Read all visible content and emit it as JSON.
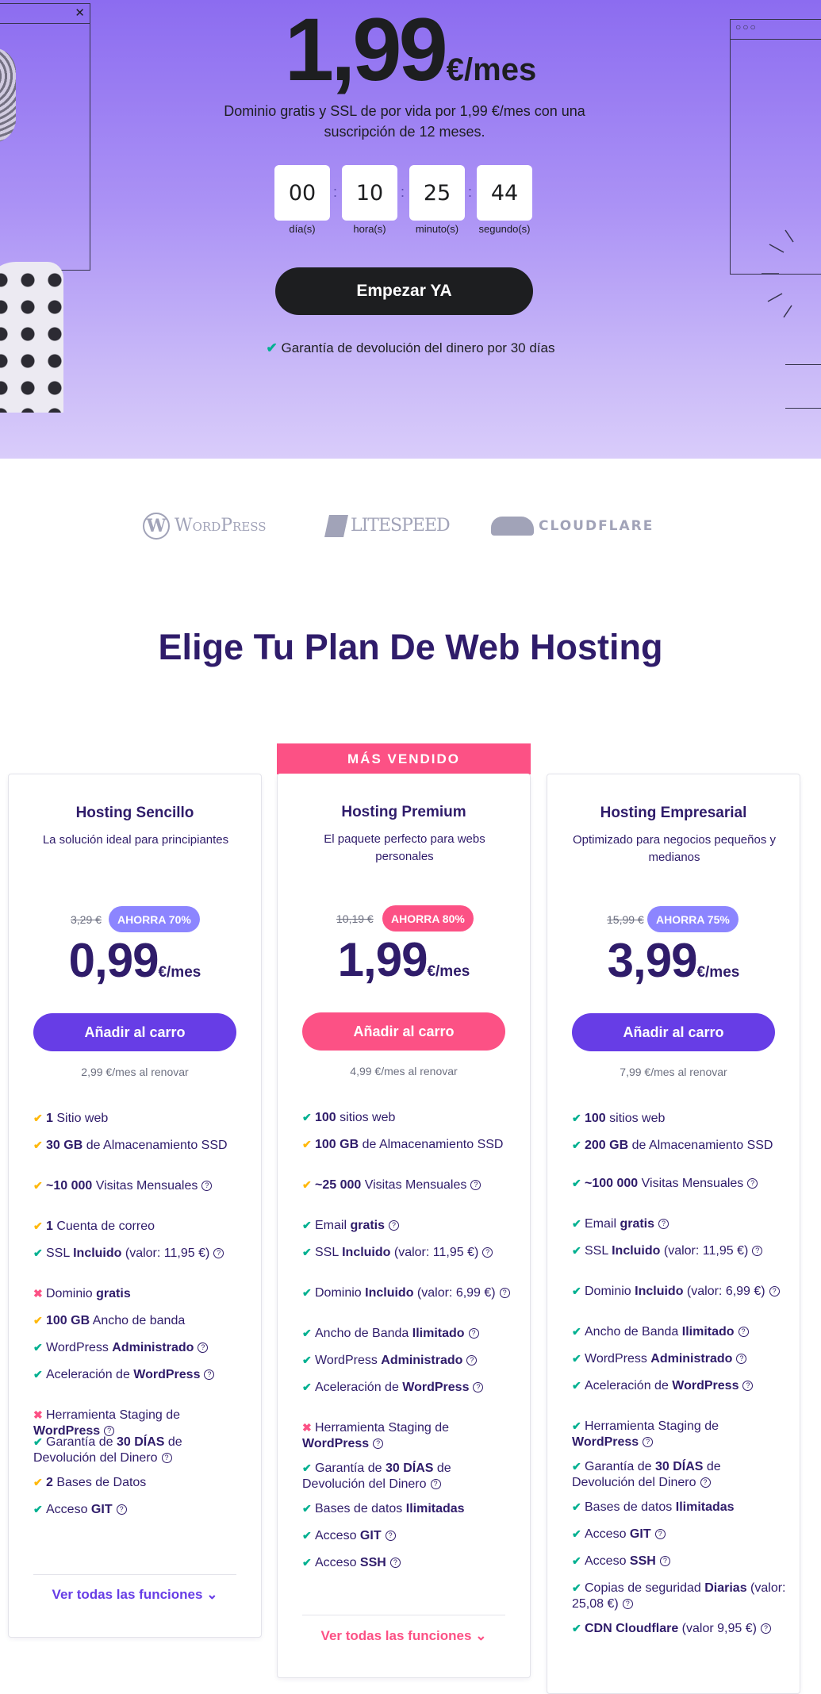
{
  "hero": {
    "price": "1,99",
    "price_unit": "€/mes",
    "subtitle": "Dominio gratis y SSL de por vida por 1,99 €/mes con una suscripción de 12 meses.",
    "countdown": [
      {
        "value": "00",
        "label": "día(s)"
      },
      {
        "value": "10",
        "label": "hora(s)"
      },
      {
        "value": "25",
        "label": "minuto(s)"
      },
      {
        "value": "44",
        "label": "segundo(s)"
      }
    ],
    "cta_label": "Empezar YA",
    "guarantee": "Garantía de devolución del dinero por 30 días"
  },
  "logos": [
    "WordPress",
    "LITESPEED",
    "CLOUDFLARE"
  ],
  "section_title": "Elige Tu Plan De Web Hosting",
  "ribbon": "MÁS VENDIDO",
  "colors": {
    "purple": "#673de6",
    "pink": "#fc5185",
    "badge_purple": "#8c85ff",
    "navy": "#2f1c6a",
    "check": "#00b090",
    "warn": "#ffb80b"
  },
  "plans": [
    {
      "title": "Hosting Sencillo",
      "desc": "La solución ideal para principiantes",
      "old_price": "3,29 €",
      "badge": "AHORRA 70%",
      "price": "0,99",
      "unit": "€/mes",
      "button": "Añadir al carro",
      "renew": "2,99 €/mes al renovar",
      "more": "Ver todas las funciones"
    },
    {
      "title": "Hosting Premium",
      "desc": "El paquete perfecto para webs personales",
      "old_price": "10,19 €",
      "badge": "AHORRA 80%",
      "price": "1,99",
      "unit": "€/mes",
      "button": "Añadir al carro",
      "renew": "4,99 €/mes al renovar",
      "more": "Ver todas las funciones"
    },
    {
      "title": "Hosting Empresarial",
      "desc": "Optimizado para negocios pequeños y medianos",
      "old_price": "15,99 €",
      "badge": "AHORRA 75%",
      "price": "3,99",
      "unit": "€/mes",
      "button": "Añadir al carro",
      "renew": "7,99 €/mes al renovar"
    }
  ],
  "features_basic": [
    [
      "warn",
      "1",
      " Sitio web",
      "",
      false
    ],
    [
      "warn",
      "30 GB",
      " de Almacenamiento SSD",
      "",
      false
    ],
    [
      "warn",
      "~10 000",
      " Visitas Mensuales",
      "",
      true
    ],
    [
      "warn",
      "1",
      " Cuenta de correo",
      "",
      false
    ],
    [
      "ok",
      "",
      "SSL ",
      "Incluido|| (valor: 11,95 €)",
      true
    ],
    [
      "no",
      "",
      "Dominio ",
      "gratis",
      false
    ],
    [
      "warn",
      "100 GB",
      " Ancho de banda",
      "",
      false
    ],
    [
      "ok",
      "",
      "WordPress ",
      "Administrado",
      true
    ],
    [
      "ok",
      "",
      "Aceleración de ",
      "WordPress",
      true
    ],
    [
      "no",
      "",
      "Herramienta Staging de ",
      "WordPress",
      true
    ],
    [
      "ok",
      "",
      "Garantía de ",
      "30 DÍAS|| de Devolución del Dinero",
      true
    ],
    [
      "warn",
      "2",
      " Bases de Datos",
      "",
      false
    ],
    [
      "ok",
      "",
      "Acceso ",
      "GIT",
      true
    ]
  ],
  "features_premium": [
    [
      "ok",
      "100",
      " sitios web",
      "",
      false
    ],
    [
      "warn",
      "100 GB",
      " de Almacenamiento SSD",
      "",
      false
    ],
    [
      "warn",
      "~25 000",
      " Visitas Mensuales",
      "",
      true
    ],
    [
      "ok",
      "",
      "Email ",
      "gratis",
      true
    ],
    [
      "ok",
      "",
      "SSL ",
      "Incluido|| (valor: 11,95 €)",
      true
    ],
    [
      "ok",
      "",
      "Dominio ",
      "Incluido|| (valor: 6,99 €)",
      true
    ],
    [
      "ok",
      "",
      "Ancho de Banda ",
      "Ilimitado",
      true
    ],
    [
      "ok",
      "",
      "WordPress ",
      "Administrado",
      true
    ],
    [
      "ok",
      "",
      "Aceleración de ",
      "WordPress",
      true
    ],
    [
      "no",
      "",
      "Herramienta Staging de ",
      "WordPress",
      true
    ],
    [
      "ok",
      "",
      "Garantía de ",
      "30 DÍAS|| de Devolución del Dinero",
      true
    ],
    [
      "ok",
      "",
      "Bases de datos ",
      "Ilimitadas",
      false
    ],
    [
      "ok",
      "",
      "Acceso ",
      "GIT",
      true
    ],
    [
      "ok",
      "",
      "Acceso ",
      "SSH",
      true
    ]
  ],
  "features_business": [
    [
      "ok",
      "100",
      " sitios web",
      "",
      false
    ],
    [
      "ok",
      "200 GB",
      " de Almacenamiento SSD",
      "",
      false
    ],
    [
      "ok",
      "~100 000",
      " Visitas Mensuales",
      "",
      true
    ],
    [
      "ok",
      "",
      "Email ",
      "gratis",
      true
    ],
    [
      "ok",
      "",
      "SSL ",
      "Incluido|| (valor: 11,95 €)",
      true
    ],
    [
      "ok",
      "",
      "Dominio ",
      "Incluido|| (valor: 6,99 €)",
      true
    ],
    [
      "ok",
      "",
      "Ancho de Banda ",
      "Ilimitado",
      true
    ],
    [
      "ok",
      "",
      "WordPress ",
      "Administrado",
      true
    ],
    [
      "ok",
      "",
      "Aceleración de ",
      "WordPress",
      true
    ],
    [
      "ok",
      "",
      "Herramienta Staging de ",
      "WordPress",
      true
    ],
    [
      "ok",
      "",
      "Garantía de ",
      "30 DÍAS|| de Devolución del Dinero",
      true
    ],
    [
      "ok",
      "",
      "Bases de datos ",
      "Ilimitadas",
      false
    ],
    [
      "ok",
      "",
      "Acceso ",
      "GIT",
      true
    ],
    [
      "ok",
      "",
      "Acceso ",
      "SSH",
      true
    ],
    [
      "ok",
      "",
      "Copias de seguridad ",
      "Diarias|| (valor: 25,08 €)",
      true
    ],
    [
      "ok",
      "",
      "",
      "CDN Cloudflare|| (valor 9,95 €)",
      true
    ]
  ]
}
